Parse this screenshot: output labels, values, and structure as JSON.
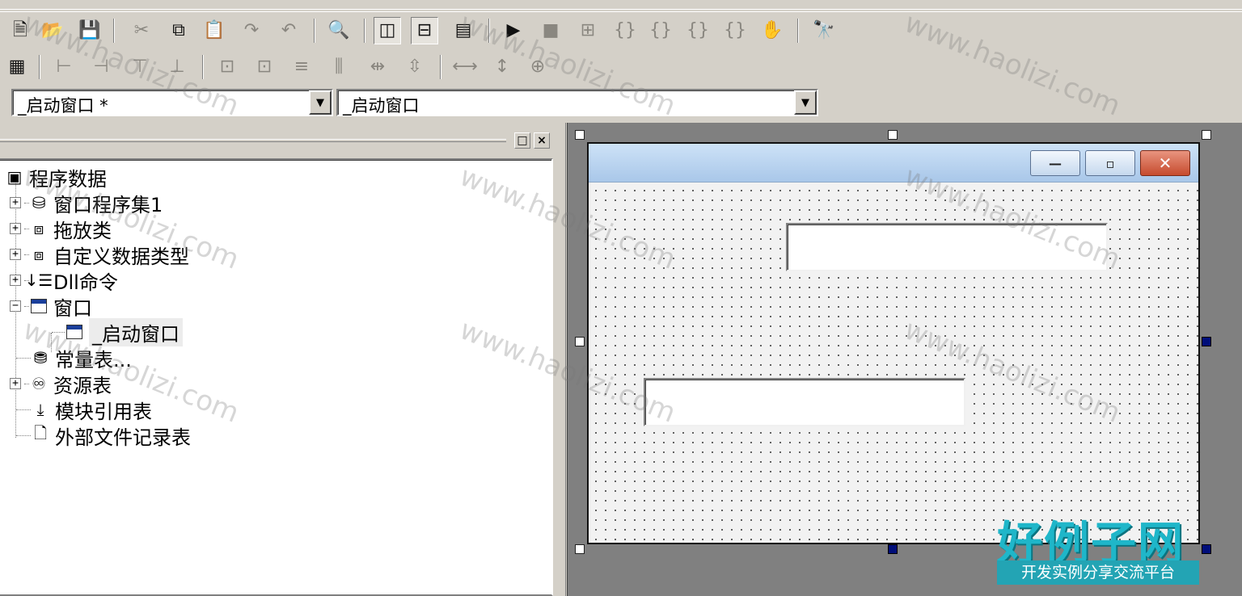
{
  "toolbar1": {
    "icons": [
      "new-file-icon",
      "open-folder-icon",
      "save-icon",
      "cut-icon",
      "copy-icon",
      "paste-icon",
      "redo-icon",
      "undo-icon",
      "find-icon",
      "view-layout-1-icon",
      "view-layout-2-icon",
      "view-layout-3-icon",
      "run-icon",
      "stop-icon",
      "compile-icon",
      "step-into-icon",
      "step-over-icon",
      "step-out-icon",
      "run-to-cursor-icon",
      "hand-icon",
      "help-search-icon"
    ]
  },
  "toolbar2": {
    "icons": [
      "form-icon",
      "align-left-icon",
      "align-right-icon",
      "align-top-icon",
      "align-bottom-icon",
      "center-horizontal-icon",
      "center-vertical-icon",
      "space-horizontal-icon",
      "space-vertical-icon",
      "distribute-horizontal-icon",
      "distribute-vertical-icon",
      "same-width-icon",
      "same-height-icon",
      "same-size-icon"
    ]
  },
  "combos": {
    "left": "_启动窗口 *",
    "right": "_启动窗口"
  },
  "tree": {
    "root": "程序数据",
    "items": [
      {
        "label": "窗口程序集1",
        "expander": "+"
      },
      {
        "label": "拖放类",
        "expander": "+"
      },
      {
        "label": "自定义数据类型",
        "expander": "+"
      },
      {
        "label": "Dll命令",
        "expander": "+"
      },
      {
        "label": "窗口",
        "expander": "−"
      },
      {
        "label": "_启动窗口",
        "expander": ""
      },
      {
        "label": "常量表...",
        "expander": ""
      },
      {
        "label": "资源表",
        "expander": "+"
      },
      {
        "label": "模块引用表",
        "expander": ""
      },
      {
        "label": "外部文件记录表",
        "expander": ""
      }
    ]
  },
  "panel_buttons": {
    "restore": "□",
    "close": "×"
  },
  "form": {
    "buttons": {
      "minimize": "—",
      "maximize": "▫",
      "close": "✕"
    }
  },
  "watermark": {
    "text": "www.haolizi.com"
  },
  "logo": {
    "title": "好例子网",
    "subtitle": "开发实例分享交流平台"
  }
}
